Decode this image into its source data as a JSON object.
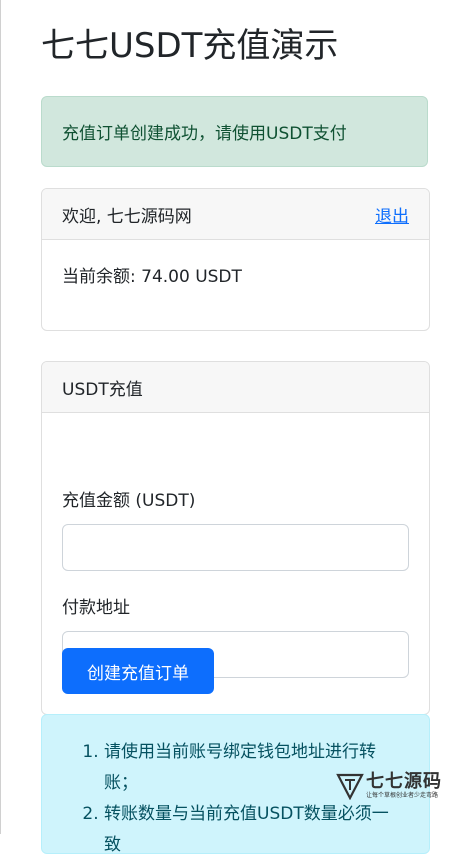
{
  "page": {
    "title": "七七USDT充值演示"
  },
  "success_alert": {
    "text": "充值订单创建成功，请使用USDT支付"
  },
  "account_card": {
    "welcome": "欢迎, 七七源码网",
    "logout_label": "退出",
    "balance": "当前余额: 74.00 USDT"
  },
  "recharge_card": {
    "header": "USDT充值",
    "amount_label": "充值金额 (USDT)",
    "amount_value": "",
    "address_label": "付款地址",
    "address_value": "",
    "submit_label": "创建充值订单"
  },
  "info_alert": {
    "items": [
      "请使用当前账号绑定钱包地址进行转账；",
      "转账数量与当前充值USDT数量必须一致"
    ]
  },
  "watermark": {
    "title": "七七源码",
    "subtitle": "让每个草根创业者少走弯路"
  },
  "colors": {
    "primary": "#0d6efd",
    "success_bg": "#d1e7dd",
    "info_bg": "#cff4fc"
  }
}
